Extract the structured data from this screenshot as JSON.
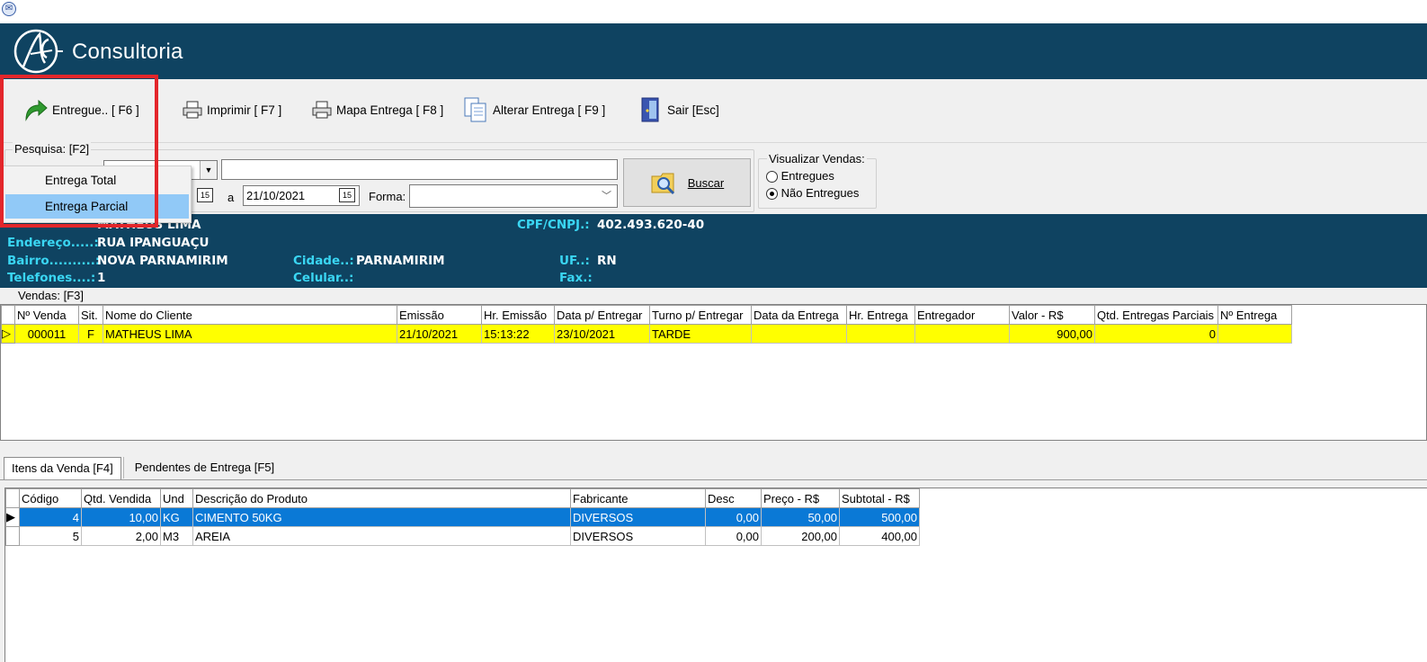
{
  "app": {
    "brand": "Consultoria"
  },
  "toolbar": {
    "entregue": "Entregue.. [ F6 ]",
    "imprimir": "Imprimir  [ F7 ]",
    "mapa": "Mapa Entrega  [ F8 ]",
    "alterar": "Alterar Entrega [ F9 ]",
    "sair": "Sair [Esc]"
  },
  "search": {
    "group_title": "Pesquisa: [F2]",
    "text_value": "",
    "date_to": "21/10/2021",
    "a_label": "a",
    "forma_label": "Forma:",
    "forma_value": "",
    "buscar": "Buscar",
    "cal_glyph": "15"
  },
  "visualizar": {
    "title": "Visualizar Vendas:",
    "opt1": "Entregues",
    "opt2": "Não Entregues",
    "selected": "Não Entregues"
  },
  "menu": {
    "items": [
      "Entrega Total",
      "Entrega Parcial"
    ],
    "highlighted": "Entrega Parcial"
  },
  "client": {
    "name": "MATHEUS LIMA",
    "cpf_label": "CPF/CNPJ.:",
    "cpf": "402.493.620-40",
    "endereco_label": "Endereço.....:",
    "endereco": "RUA IPANGUAÇU",
    "bairro_label": "Bairro..........:",
    "bairro": "NOVA PARNAMIRIM",
    "cidade_label": "Cidade..:",
    "cidade": "PARNAMIRIM",
    "uf_label": "UF..:",
    "uf": "RN",
    "telefones_label": "Telefones....:",
    "telefones": "1",
    "celular_label": "Celular..:",
    "fax_label": "Fax.:"
  },
  "vendas": {
    "title": "Vendas: [F3]",
    "columns": [
      "Nº Venda",
      "Sit.",
      "Nome do Cliente",
      "Emissão",
      "Hr. Emissão",
      "Data p/ Entregar",
      "Turno p/ Entregar",
      "Data da Entrega",
      "Hr. Entrega",
      "Entregador",
      "Valor - R$",
      "Qtd. Entregas Parciais",
      "Nº Entrega"
    ],
    "row": {
      "numero": "000011",
      "sit": "F",
      "cliente": "MATHEUS LIMA",
      "emissao": "21/10/2021",
      "hr_emissao": "15:13:22",
      "data_entregar": "23/10/2021",
      "turno": "TARDE",
      "data_entrega": "",
      "hr_entrega": "",
      "entregador": "",
      "valor": "900,00",
      "qtd_parciais": "0",
      "num_entrega": ""
    }
  },
  "tabs": [
    "Itens da Venda [F4]",
    "Pendentes de Entrega [F5]"
  ],
  "itens": {
    "columns": [
      "Código",
      "Qtd. Vendida",
      "Und",
      "Descrição do Produto",
      "Fabricante",
      "Desc",
      "Preço - R$",
      "Subtotal - R$"
    ],
    "rows": [
      {
        "codigo": "4",
        "qtd": "10,00",
        "und": "KG",
        "descricao": "CIMENTO 50KG",
        "fabricante": "DIVERSOS",
        "desc": "0,00",
        "preco": "50,00",
        "subtotal": "500,00"
      },
      {
        "codigo": "5",
        "qtd": "2,00",
        "und": "M3",
        "descricao": "AREIA",
        "fabricante": "DIVERSOS",
        "desc": "0,00",
        "preco": "200,00",
        "subtotal": "400,00"
      }
    ]
  },
  "colors": {
    "banner": "#0f4361",
    "label_cyan": "#3ad6f3",
    "selected_row": "#0a79d6",
    "highlight_row": "#ffff00",
    "annotation_red": "#e3262b"
  }
}
